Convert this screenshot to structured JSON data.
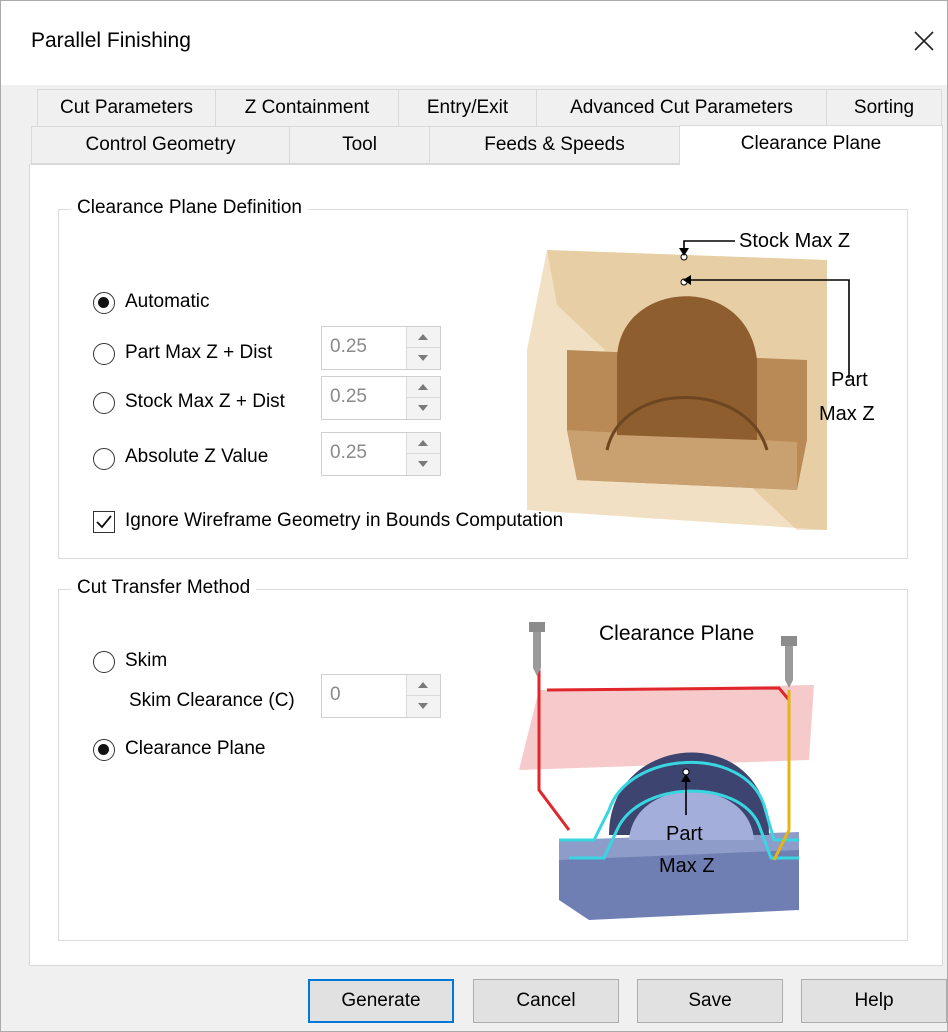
{
  "window": {
    "title": "Parallel Finishing"
  },
  "tabs_row1": [
    "Cut Parameters",
    "Z Containment",
    "Entry/Exit",
    "Advanced Cut Parameters",
    "Sorting"
  ],
  "tabs_row2": [
    "Control Geometry",
    "Tool",
    "Feeds & Speeds",
    "Clearance Plane"
  ],
  "active_tab": "Clearance Plane",
  "clearance_def": {
    "title": "Clearance Plane Definition",
    "options": [
      {
        "label": "Automatic",
        "selected": true
      },
      {
        "label": "Part Max Z + Dist",
        "selected": false,
        "value": "0.25"
      },
      {
        "label": "Stock Max Z + Dist",
        "selected": false,
        "value": "0.25"
      },
      {
        "label": "Absolute Z Value",
        "selected": false,
        "value": "0.25"
      }
    ],
    "ignore_wireframe": {
      "label": "Ignore Wireframe Geometry in Bounds Computation",
      "checked": true
    },
    "illustration": {
      "stock_label": "Stock Max Z",
      "part_label_1": "Part",
      "part_label_2": "Max Z"
    }
  },
  "cut_transfer": {
    "title": "Cut Transfer Method",
    "skim": {
      "label": "Skim",
      "selected": false
    },
    "skim_clearance": {
      "label": "Skim Clearance (C)",
      "value": "0"
    },
    "clearance_plane": {
      "label": "Clearance Plane",
      "selected": true
    },
    "illustration": {
      "plane_label": "Clearance Plane",
      "part_label_1": "Part",
      "part_label_2": "Max Z"
    }
  },
  "buttons": {
    "generate": "Generate",
    "cancel": "Cancel",
    "save": "Save",
    "help": "Help"
  },
  "colors": {
    "accent": "#0078d7",
    "stock": "#e6c290",
    "part": "#a06f3f",
    "plane": "#f3b8b8",
    "path_red": "#e0262b",
    "path_cyan": "#38d6e0",
    "path_yellow": "#e6b415",
    "blue_part": "#6f7fb4"
  }
}
